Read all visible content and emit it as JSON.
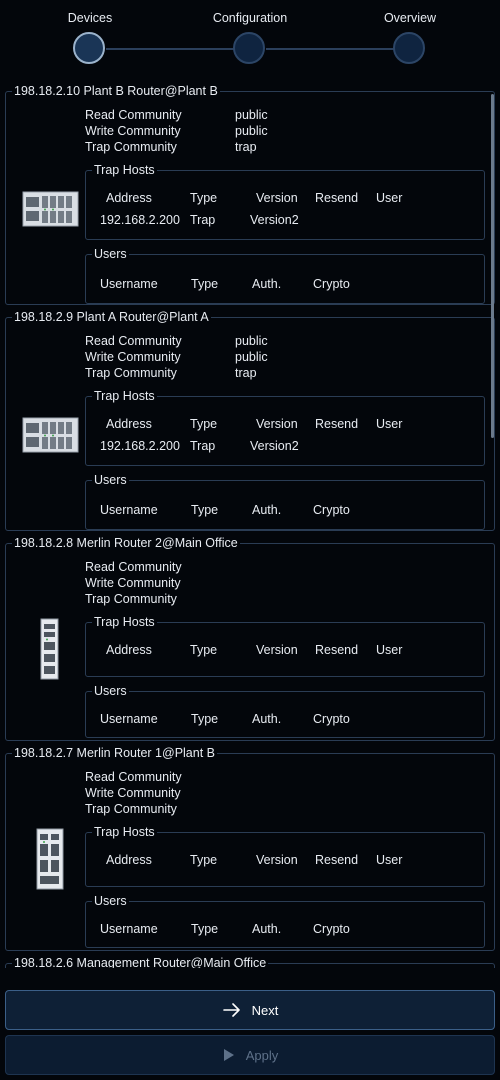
{
  "stepper": {
    "steps": [
      {
        "label": "Devices",
        "active": true
      },
      {
        "label": "Configuration",
        "active": false
      },
      {
        "label": "Overview",
        "active": false
      }
    ]
  },
  "devices": [
    {
      "title": "198.18.2.10 Plant B Router@Plant B",
      "image_icon": "rack-switch-icon",
      "read_community_label": "Read Community",
      "read_community": "public",
      "write_community_label": "Write Community",
      "write_community": "public",
      "trap_community_label": "Trap Community",
      "trap_community": "trap",
      "trap_hosts": {
        "legend": "Trap Hosts",
        "headers": [
          "Address",
          "Type",
          "Version",
          "Resend",
          "User"
        ],
        "rows": [
          [
            "192.168.2.200",
            "Trap",
            "Version2",
            "",
            ""
          ]
        ]
      },
      "users": {
        "legend": "Users",
        "headers": [
          "Username",
          "Type",
          "Auth.",
          "Crypto"
        ]
      }
    },
    {
      "title": "198.18.2.9 Plant A Router@Plant A",
      "image_icon": "rack-switch-icon",
      "read_community_label": "Read Community",
      "read_community": "public",
      "write_community_label": "Write Community",
      "write_community": "public",
      "trap_community_label": "Trap Community",
      "trap_community": "trap",
      "trap_hosts": {
        "legend": "Trap Hosts",
        "headers": [
          "Address",
          "Type",
          "Version",
          "Resend",
          "User"
        ],
        "rows": [
          [
            "192.168.2.200",
            "Trap",
            "Version2",
            "",
            ""
          ]
        ]
      },
      "users": {
        "legend": "Users",
        "headers": [
          "Username",
          "Type",
          "Auth.",
          "Crypto"
        ]
      }
    },
    {
      "title": "198.18.2.8 Merlin Router 2@Main Office",
      "image_icon": "din-rail-router-icon",
      "read_community_label": "Read Community",
      "read_community": "",
      "write_community_label": "Write Community",
      "write_community": "",
      "trap_community_label": "Trap Community",
      "trap_community": "",
      "trap_hosts": {
        "legend": "Trap Hosts",
        "headers": [
          "Address",
          "Type",
          "Version",
          "Resend",
          "User"
        ],
        "rows": []
      },
      "users": {
        "legend": "Users",
        "headers": [
          "Username",
          "Type",
          "Auth.",
          "Crypto"
        ]
      }
    },
    {
      "title": "198.18.2.7 Merlin Router 1@Plant B",
      "image_icon": "din-rail-router-icon",
      "read_community_label": "Read Community",
      "read_community": "",
      "write_community_label": "Write Community",
      "write_community": "",
      "trap_community_label": "Trap Community",
      "trap_community": "",
      "trap_hosts": {
        "legend": "Trap Hosts",
        "headers": [
          "Address",
          "Type",
          "Version",
          "Resend",
          "User"
        ],
        "rows": []
      },
      "users": {
        "legend": "Users",
        "headers": [
          "Username",
          "Type",
          "Auth.",
          "Crypto"
        ]
      }
    },
    {
      "title": "198.18.2.6 Management Router@Main Office"
    }
  ],
  "buttons": {
    "next_label": "Next",
    "next_icon": "arrow-right-icon",
    "apply_label": "Apply",
    "apply_icon": "play-icon"
  }
}
